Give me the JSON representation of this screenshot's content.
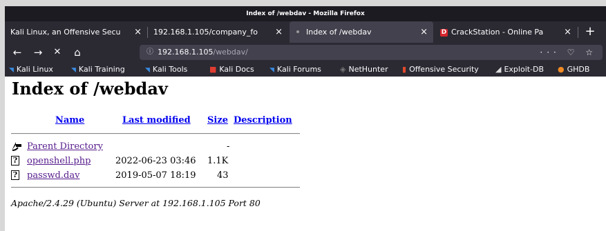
{
  "window": {
    "title": "Index of /webdav - Mozilla Firefox"
  },
  "tabs": [
    {
      "label": "Kali Linux, an Offensive Secu",
      "active": false
    },
    {
      "label": "192.168.1.105/company_fo",
      "active": false
    },
    {
      "label": "Index of /webdav",
      "active": true
    },
    {
      "label": "CrackStation - Online Pa",
      "active": false
    }
  ],
  "nav": {
    "back_icon": "←",
    "forward_icon": "→",
    "stop_icon": "✕",
    "home_icon": "⌂",
    "url_host": "192.168.1.105",
    "url_path": "/webdav/",
    "url_info_icon": "ⓘ",
    "url_right_icons": "··· ♡ ☆"
  },
  "bookmarks": [
    {
      "label": "Kali Linux",
      "icon": "kali-dragon-icon"
    },
    {
      "label": "Kali Training",
      "icon": "kali-dragon-icon"
    },
    {
      "label": "Kali Tools",
      "icon": "kali-dragon-icon"
    },
    {
      "label": "Kali Docs",
      "icon": "kali-docs-icon"
    },
    {
      "label": "Kali Forums",
      "icon": "kali-dragon-icon"
    },
    {
      "label": "NetHunter",
      "icon": "nethunter-icon"
    },
    {
      "label": "Offensive Security",
      "icon": "offsec-icon"
    },
    {
      "label": "Exploit-DB",
      "icon": "exploitdb-icon"
    },
    {
      "label": "GHDB",
      "icon": "ghdb-icon"
    }
  ],
  "page": {
    "heading": "Index of /webdav",
    "columns": {
      "name": "Name",
      "modified": "Last modified",
      "size": "Size",
      "description": "Description"
    },
    "parent": {
      "label": "Parent Directory",
      "size": "-"
    },
    "rows": [
      {
        "name": "openshell.php",
        "modified": "2022-06-23 03:46",
        "size": "1.1K"
      },
      {
        "name": "passwd.dav",
        "modified": "2019-05-07 18:19",
        "size": "43"
      }
    ],
    "address": "Apache/2.4.29 (Ubuntu) Server at 192.168.1.105 Port 80"
  }
}
